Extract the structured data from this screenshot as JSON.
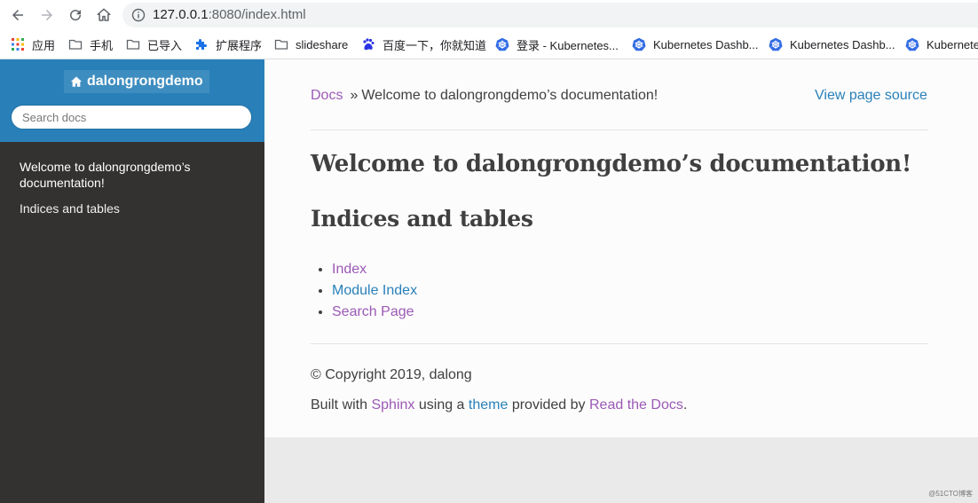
{
  "browser": {
    "url_host": "127.0.0.1",
    "url_rest": ":8080/index.html",
    "bookmarks": [
      {
        "label": "应用",
        "icon": "apps-grid-icon"
      },
      {
        "label": "手机",
        "icon": "folder-icon"
      },
      {
        "label": "已导入",
        "icon": "folder-icon"
      },
      {
        "label": "扩展程序",
        "icon": "puzzle-icon"
      },
      {
        "label": "slideshare",
        "icon": "folder-icon"
      },
      {
        "label": "百度一下，你就知道",
        "icon": "baidu-paw-icon"
      },
      {
        "label": "登录 - Kubernetes...",
        "icon": "kubernetes-icon"
      },
      {
        "label": "Kubernetes Dashb...",
        "icon": "kubernetes-icon"
      },
      {
        "label": "Kubernetes Dashb...",
        "icon": "kubernetes-icon"
      },
      {
        "label": "Kubernete",
        "icon": "kubernetes-icon"
      }
    ]
  },
  "sidebar": {
    "brand": "dalongrongdemo",
    "search_placeholder": "Search docs",
    "items": [
      {
        "label": "Welcome to dalongrongdemo’s documentation!"
      },
      {
        "label": "Indices and tables"
      }
    ]
  },
  "breadcrumb": {
    "docs": "Docs",
    "separator": "»",
    "current": "Welcome to dalongrongdemo’s documentation!",
    "view_source": "View page source"
  },
  "main": {
    "title": "Welcome to dalongrongdemo’s documentation!",
    "subtitle": "Indices and tables",
    "links": [
      {
        "label": "Index",
        "color": "#9b59b6"
      },
      {
        "label": "Module Index",
        "color": "#2980b9"
      },
      {
        "label": "Search Page",
        "color": "#9b59b6"
      }
    ]
  },
  "footer": {
    "copyright": "© Copyright 2019, dalong",
    "built_prefix": "Built with",
    "sphinx": "Sphinx",
    "using_a": "using a",
    "theme": "theme",
    "provided_by": "provided by",
    "rtd": "Read the Docs",
    "period": "."
  },
  "watermark": "@51CTO博客",
  "colors": {
    "sidebar_bg": "#343131",
    "sidebar_top": "#2980b9",
    "link_blue": "#2980b9",
    "link_visited": "#9b59b6",
    "text": "#404040"
  }
}
